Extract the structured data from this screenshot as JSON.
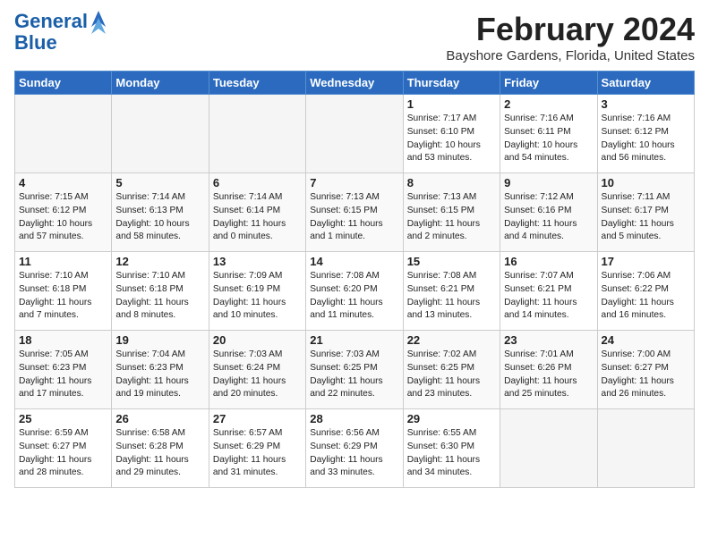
{
  "header": {
    "logo_line1": "General",
    "logo_line2": "Blue",
    "title": "February 2024",
    "subtitle": "Bayshore Gardens, Florida, United States"
  },
  "weekdays": [
    "Sunday",
    "Monday",
    "Tuesday",
    "Wednesday",
    "Thursday",
    "Friday",
    "Saturday"
  ],
  "weeks": [
    [
      {
        "date": "",
        "info": ""
      },
      {
        "date": "",
        "info": ""
      },
      {
        "date": "",
        "info": ""
      },
      {
        "date": "",
        "info": ""
      },
      {
        "date": "1",
        "info": "Sunrise: 7:17 AM\nSunset: 6:10 PM\nDaylight: 10 hours\nand 53 minutes."
      },
      {
        "date": "2",
        "info": "Sunrise: 7:16 AM\nSunset: 6:11 PM\nDaylight: 10 hours\nand 54 minutes."
      },
      {
        "date": "3",
        "info": "Sunrise: 7:16 AM\nSunset: 6:12 PM\nDaylight: 10 hours\nand 56 minutes."
      }
    ],
    [
      {
        "date": "4",
        "info": "Sunrise: 7:15 AM\nSunset: 6:12 PM\nDaylight: 10 hours\nand 57 minutes."
      },
      {
        "date": "5",
        "info": "Sunrise: 7:14 AM\nSunset: 6:13 PM\nDaylight: 10 hours\nand 58 minutes."
      },
      {
        "date": "6",
        "info": "Sunrise: 7:14 AM\nSunset: 6:14 PM\nDaylight: 11 hours\nand 0 minutes."
      },
      {
        "date": "7",
        "info": "Sunrise: 7:13 AM\nSunset: 6:15 PM\nDaylight: 11 hours\nand 1 minute."
      },
      {
        "date": "8",
        "info": "Sunrise: 7:13 AM\nSunset: 6:15 PM\nDaylight: 11 hours\nand 2 minutes."
      },
      {
        "date": "9",
        "info": "Sunrise: 7:12 AM\nSunset: 6:16 PM\nDaylight: 11 hours\nand 4 minutes."
      },
      {
        "date": "10",
        "info": "Sunrise: 7:11 AM\nSunset: 6:17 PM\nDaylight: 11 hours\nand 5 minutes."
      }
    ],
    [
      {
        "date": "11",
        "info": "Sunrise: 7:10 AM\nSunset: 6:18 PM\nDaylight: 11 hours\nand 7 minutes."
      },
      {
        "date": "12",
        "info": "Sunrise: 7:10 AM\nSunset: 6:18 PM\nDaylight: 11 hours\nand 8 minutes."
      },
      {
        "date": "13",
        "info": "Sunrise: 7:09 AM\nSunset: 6:19 PM\nDaylight: 11 hours\nand 10 minutes."
      },
      {
        "date": "14",
        "info": "Sunrise: 7:08 AM\nSunset: 6:20 PM\nDaylight: 11 hours\nand 11 minutes."
      },
      {
        "date": "15",
        "info": "Sunrise: 7:08 AM\nSunset: 6:21 PM\nDaylight: 11 hours\nand 13 minutes."
      },
      {
        "date": "16",
        "info": "Sunrise: 7:07 AM\nSunset: 6:21 PM\nDaylight: 11 hours\nand 14 minutes."
      },
      {
        "date": "17",
        "info": "Sunrise: 7:06 AM\nSunset: 6:22 PM\nDaylight: 11 hours\nand 16 minutes."
      }
    ],
    [
      {
        "date": "18",
        "info": "Sunrise: 7:05 AM\nSunset: 6:23 PM\nDaylight: 11 hours\nand 17 minutes."
      },
      {
        "date": "19",
        "info": "Sunrise: 7:04 AM\nSunset: 6:23 PM\nDaylight: 11 hours\nand 19 minutes."
      },
      {
        "date": "20",
        "info": "Sunrise: 7:03 AM\nSunset: 6:24 PM\nDaylight: 11 hours\nand 20 minutes."
      },
      {
        "date": "21",
        "info": "Sunrise: 7:03 AM\nSunset: 6:25 PM\nDaylight: 11 hours\nand 22 minutes."
      },
      {
        "date": "22",
        "info": "Sunrise: 7:02 AM\nSunset: 6:25 PM\nDaylight: 11 hours\nand 23 minutes."
      },
      {
        "date": "23",
        "info": "Sunrise: 7:01 AM\nSunset: 6:26 PM\nDaylight: 11 hours\nand 25 minutes."
      },
      {
        "date": "24",
        "info": "Sunrise: 7:00 AM\nSunset: 6:27 PM\nDaylight: 11 hours\nand 26 minutes."
      }
    ],
    [
      {
        "date": "25",
        "info": "Sunrise: 6:59 AM\nSunset: 6:27 PM\nDaylight: 11 hours\nand 28 minutes."
      },
      {
        "date": "26",
        "info": "Sunrise: 6:58 AM\nSunset: 6:28 PM\nDaylight: 11 hours\nand 29 minutes."
      },
      {
        "date": "27",
        "info": "Sunrise: 6:57 AM\nSunset: 6:29 PM\nDaylight: 11 hours\nand 31 minutes."
      },
      {
        "date": "28",
        "info": "Sunrise: 6:56 AM\nSunset: 6:29 PM\nDaylight: 11 hours\nand 33 minutes."
      },
      {
        "date": "29",
        "info": "Sunrise: 6:55 AM\nSunset: 6:30 PM\nDaylight: 11 hours\nand 34 minutes."
      },
      {
        "date": "",
        "info": ""
      },
      {
        "date": "",
        "info": ""
      }
    ]
  ]
}
